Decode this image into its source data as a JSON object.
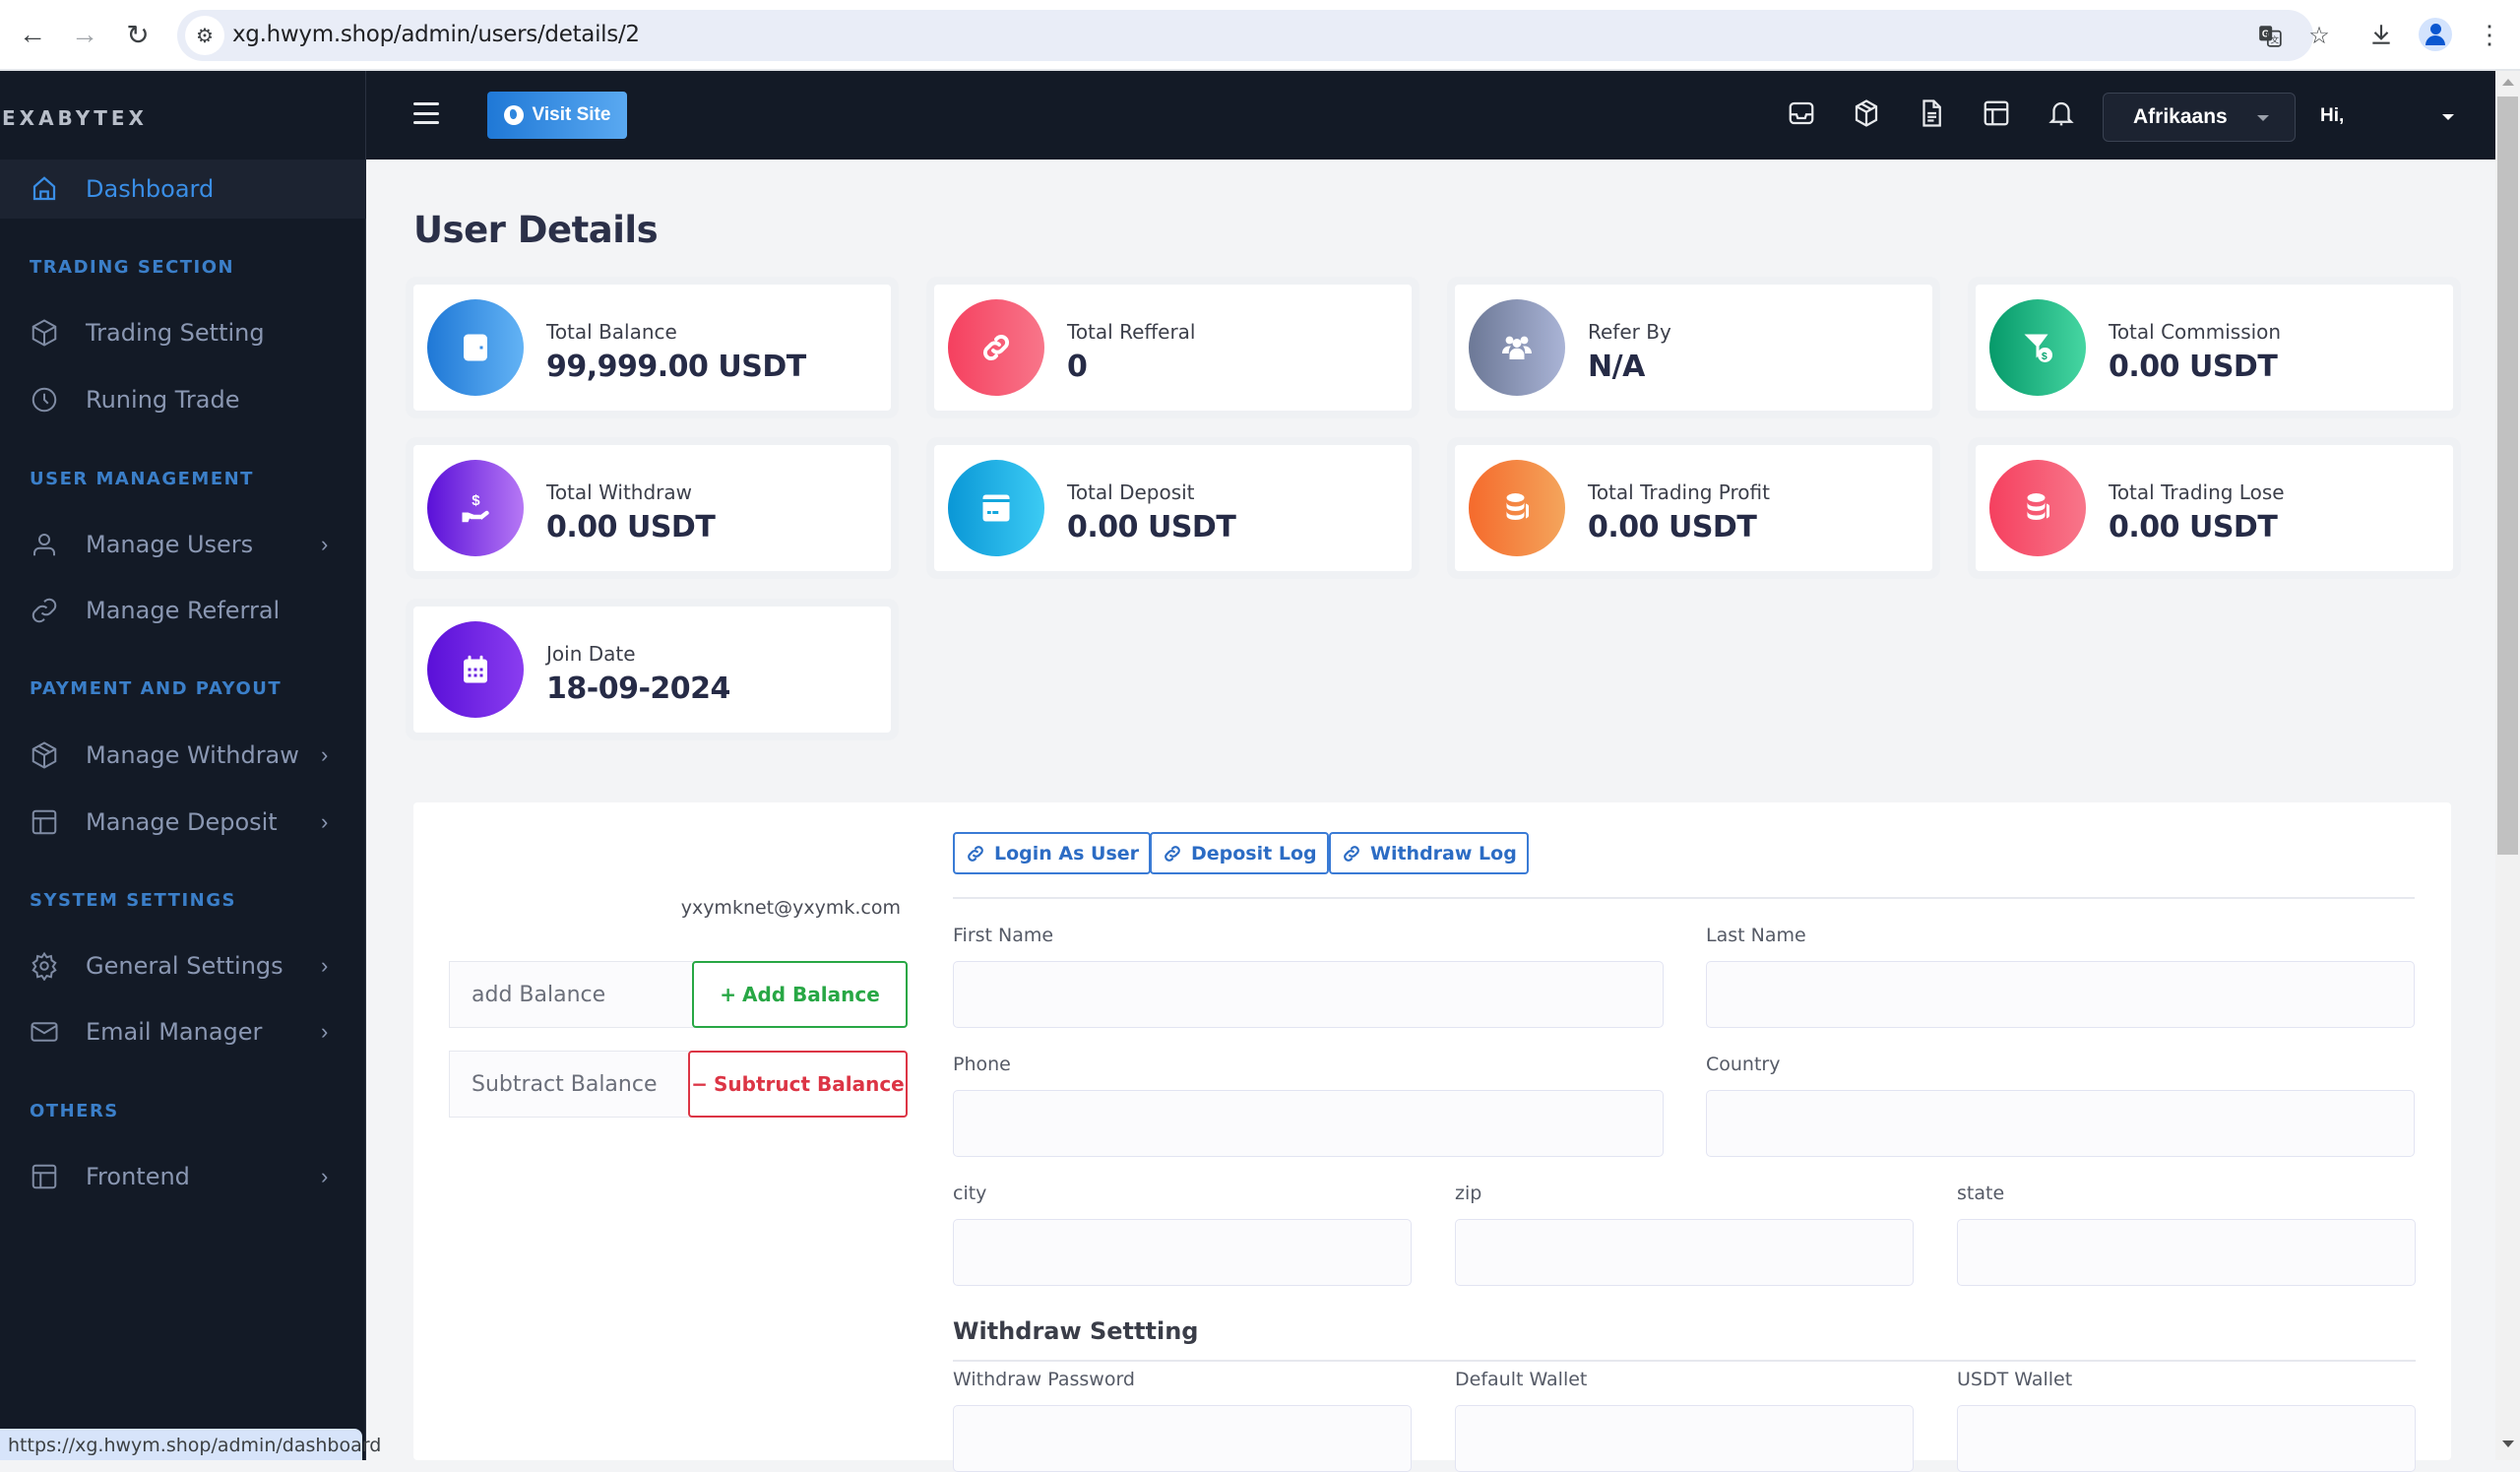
{
  "browser": {
    "url": "xg.hwym.shop/admin/users/details/2",
    "status_url": "https://xg.hwym.shop/admin/dashboard"
  },
  "sidebar": {
    "brand": "EXABYTEX",
    "active": {
      "label": "Dashboard",
      "icon": "home-icon"
    },
    "sections": [
      {
        "title": "TRADING SECTION",
        "items": [
          {
            "label": "Trading Setting",
            "icon": "cube-icon",
            "has_submenu": false
          },
          {
            "label": "Runing Trade",
            "icon": "clock-icon",
            "has_submenu": false
          }
        ]
      },
      {
        "title": "USER MANAGEMENT",
        "items": [
          {
            "label": "Manage Users",
            "icon": "user-icon",
            "has_submenu": true
          },
          {
            "label": "Manage Referral",
            "icon": "link-icon",
            "has_submenu": false
          }
        ]
      },
      {
        "title": "PAYMENT AND PAYOUT",
        "items": [
          {
            "label": "Manage Withdraw",
            "icon": "box-icon",
            "has_submenu": true
          },
          {
            "label": "Manage Deposit",
            "icon": "layout-icon",
            "has_submenu": true
          }
        ]
      },
      {
        "title": "SYSTEM SETTINGS",
        "items": [
          {
            "label": "General Settings",
            "icon": "gear-icon",
            "has_submenu": true
          },
          {
            "label": "Email Manager",
            "icon": "mail-icon",
            "has_submenu": true
          }
        ]
      },
      {
        "title": "OTHERS",
        "items": [
          {
            "label": "Frontend",
            "icon": "layout-icon",
            "has_submenu": true
          }
        ]
      }
    ],
    "chevron": "›"
  },
  "header": {
    "visit_site": "Visit Site",
    "icons": [
      "inbox-icon",
      "package-icon",
      "document-icon",
      "table-icon",
      "bell-icon"
    ],
    "language": "Afrikaans",
    "greeting": "Hi,"
  },
  "page": {
    "title": "User Details",
    "stats": [
      {
        "label": "Total Balance",
        "value": "99,999.00 USDT",
        "icon": "wallet-icon",
        "gradient": [
          "#1f78d6",
          "#63b3f5"
        ]
      },
      {
        "label": "Total Refferal",
        "value": "0",
        "icon": "link-icon",
        "gradient": [
          "#f5405f",
          "#f8768a"
        ]
      },
      {
        "label": "Refer By",
        "value": "N/A",
        "icon": "users-icon",
        "gradient": [
          "#6c7896",
          "#aab4d6"
        ]
      },
      {
        "label": "Total Commission",
        "value": "0.00 USDT",
        "icon": "funnel-dollar-icon",
        "gradient": [
          "#069a6a",
          "#46d6a2"
        ]
      },
      {
        "label": "Total Withdraw",
        "value": "0.00 USDT",
        "icon": "hand-dollar-icon",
        "gradient": [
          "#5a10d8",
          "#b678f5"
        ]
      },
      {
        "label": "Total Deposit",
        "value": "0.00 USDT",
        "icon": "credit-card-icon",
        "gradient": [
          "#0a97d6",
          "#3ccbf4"
        ]
      },
      {
        "label": "Total Trading Profit",
        "value": "0.00 USDT",
        "icon": "coins-icon",
        "gradient": [
          "#f56a2c",
          "#f4a55c"
        ]
      },
      {
        "label": "Total Trading Lose",
        "value": "0.00 USDT",
        "icon": "coins-icon",
        "gradient": [
          "#f5405f",
          "#f8768a"
        ]
      },
      {
        "label": "Join Date",
        "value": "18-09-2024",
        "icon": "calendar-icon",
        "gradient": [
          "#5a10d8",
          "#8a3df0"
        ]
      }
    ]
  },
  "panel": {
    "email": "yxymknet@yxymk.com",
    "add_balance": {
      "placeholder": "add Balance",
      "button": "Add Balance",
      "icon": "+"
    },
    "subtract_balance": {
      "placeholder": "Subtract Balance",
      "button": "Subtruct Balance",
      "icon": "−"
    },
    "log_buttons": [
      "Login As User",
      "Deposit Log",
      "Withdraw Log"
    ],
    "fields": {
      "first_name": {
        "label": "First Name",
        "value": ""
      },
      "last_name": {
        "label": "Last Name",
        "value": ""
      },
      "phone": {
        "label": "Phone",
        "value": ""
      },
      "country": {
        "label": "Country",
        "value": ""
      },
      "city": {
        "label": "city",
        "value": ""
      },
      "zip": {
        "label": "zip",
        "value": ""
      },
      "state": {
        "label": "state",
        "value": ""
      }
    },
    "withdraw_section": {
      "title": "Withdraw Settting",
      "fields": {
        "withdraw_password": {
          "label": "Withdraw Password",
          "value": ""
        },
        "default_wallet": {
          "label": "Default Wallet",
          "value": ""
        },
        "usdt_wallet": {
          "label": "USDT Wallet",
          "value": ""
        }
      }
    }
  }
}
